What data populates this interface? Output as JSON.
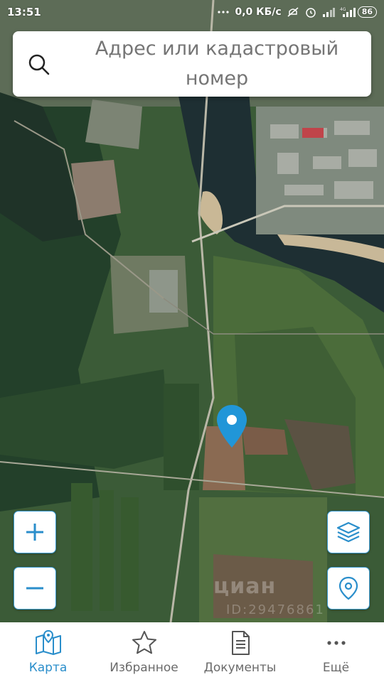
{
  "status_bar": {
    "time": "13:51",
    "network_speed": "0,0 КБ/с",
    "battery": "86",
    "network_type": "4G"
  },
  "search": {
    "placeholder": "Адрес или кадастровый номер",
    "icon": "search-icon"
  },
  "map": {
    "marker_color": "#2196d8",
    "controls": {
      "zoom_in": "+",
      "zoom_out": "−",
      "layers_icon": "layers-icon",
      "locate_icon": "location-pin-icon"
    },
    "watermark": "циан",
    "watermark_id": "ID:29476861"
  },
  "bottom_nav": {
    "items": [
      {
        "label": "Карта",
        "icon": "map-icon",
        "active": true
      },
      {
        "label": "Избранное",
        "icon": "star-icon",
        "active": false
      },
      {
        "label": "Документы",
        "icon": "document-icon",
        "active": false
      },
      {
        "label": "Ещё",
        "icon": "more-icon",
        "active": false
      }
    ]
  },
  "colors": {
    "accent": "#2a8ecb",
    "nav_text": "#6a6a6a"
  }
}
